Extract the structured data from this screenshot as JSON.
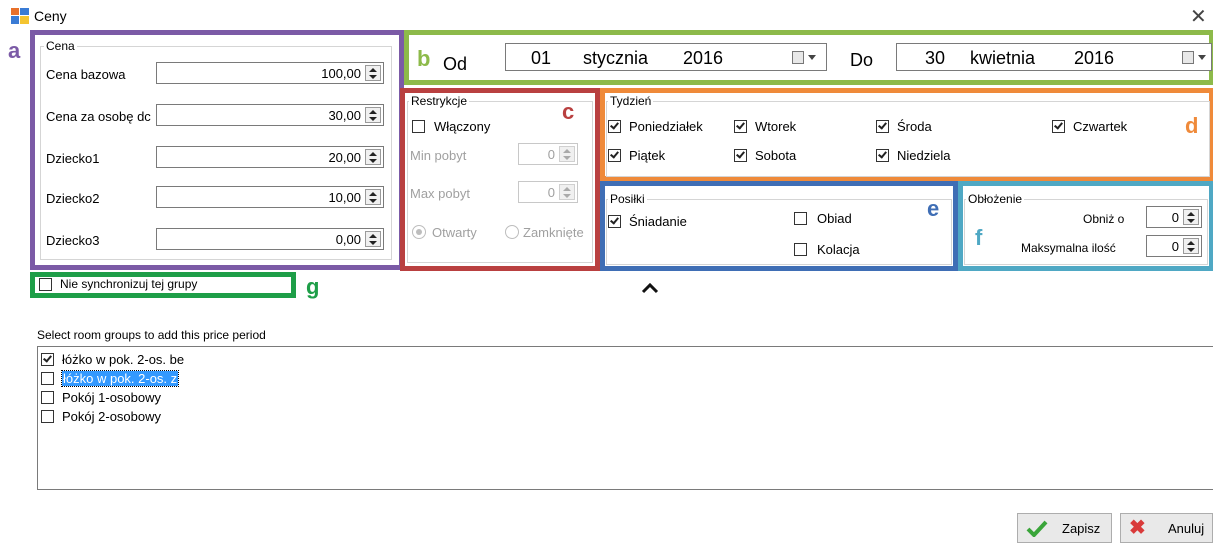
{
  "window": {
    "title": "Ceny"
  },
  "annotations": {
    "a": "a",
    "b": "b",
    "c": "c",
    "d": "d",
    "e": "e",
    "f": "f",
    "g": "g"
  },
  "annotation_colors": {
    "a": "#7b5aa6",
    "b": "#8dba4a",
    "c": "#b94040",
    "d": "#ef8a3a",
    "e": "#3f6eb5",
    "f": "#4fa8c4",
    "g": "#1e9e48"
  },
  "price": {
    "group_label": "Cena",
    "rows": [
      {
        "label": "Cena bazowa",
        "value": "100,00"
      },
      {
        "label": "Cena za osobę dc",
        "value": "30,00"
      },
      {
        "label": "Dziecko1",
        "value": "20,00"
      },
      {
        "label": "Dziecko2",
        "value": "10,00"
      },
      {
        "label": "Dziecko3",
        "value": "0,00"
      }
    ]
  },
  "dates": {
    "from_label": "Od",
    "from": {
      "day": "01",
      "month": "stycznia",
      "year": "2016"
    },
    "to_label": "Do",
    "to": {
      "day": "30",
      "month": "kwietnia",
      "year": "2016"
    }
  },
  "restrictions": {
    "group_label": "Restrykcje",
    "enabled_label": "Włączony",
    "enabled": false,
    "min_stay_label": "Min pobyt",
    "min_stay": "0",
    "max_stay_label": "Max pobyt",
    "max_stay": "0",
    "open_label": "Otwarty",
    "closed_label": "Zamknięte"
  },
  "week": {
    "group_label": "Tydzień",
    "days": [
      {
        "label": "Poniedziałek",
        "checked": true
      },
      {
        "label": "Wtorek",
        "checked": true
      },
      {
        "label": "Środa",
        "checked": true
      },
      {
        "label": "Czwartek",
        "checked": true
      },
      {
        "label": "Piątek",
        "checked": true
      },
      {
        "label": "Sobota",
        "checked": true
      },
      {
        "label": "Niedziela",
        "checked": true
      }
    ]
  },
  "meals": {
    "group_label": "Posiłki",
    "items": [
      {
        "label": "Śniadanie",
        "checked": true
      },
      {
        "label": "Obiad",
        "checked": false
      },
      {
        "label": "Kolacja",
        "checked": false
      }
    ]
  },
  "occupancy": {
    "group_label": "Obłożenie",
    "lower_label": "Obniż o",
    "lower_value": "0",
    "max_label": "Maksymalna ilość",
    "max_value": "0"
  },
  "no_sync": {
    "label": "Nie synchronizuj tej grupy",
    "checked": false
  },
  "room_groups": {
    "prompt": "Select room groups to add this price period",
    "items": [
      {
        "label": "łóżko w pok. 2-os. be",
        "checked": true,
        "selected": false
      },
      {
        "label": "łóżko w pok. 2-os. z ",
        "checked": false,
        "selected": true
      },
      {
        "label": "Pokój 1-osobowy",
        "checked": false,
        "selected": false
      },
      {
        "label": "Pokój 2-osobowy",
        "checked": false,
        "selected": false
      }
    ]
  },
  "buttons": {
    "save": "Zapisz",
    "cancel": "Anuluj"
  }
}
